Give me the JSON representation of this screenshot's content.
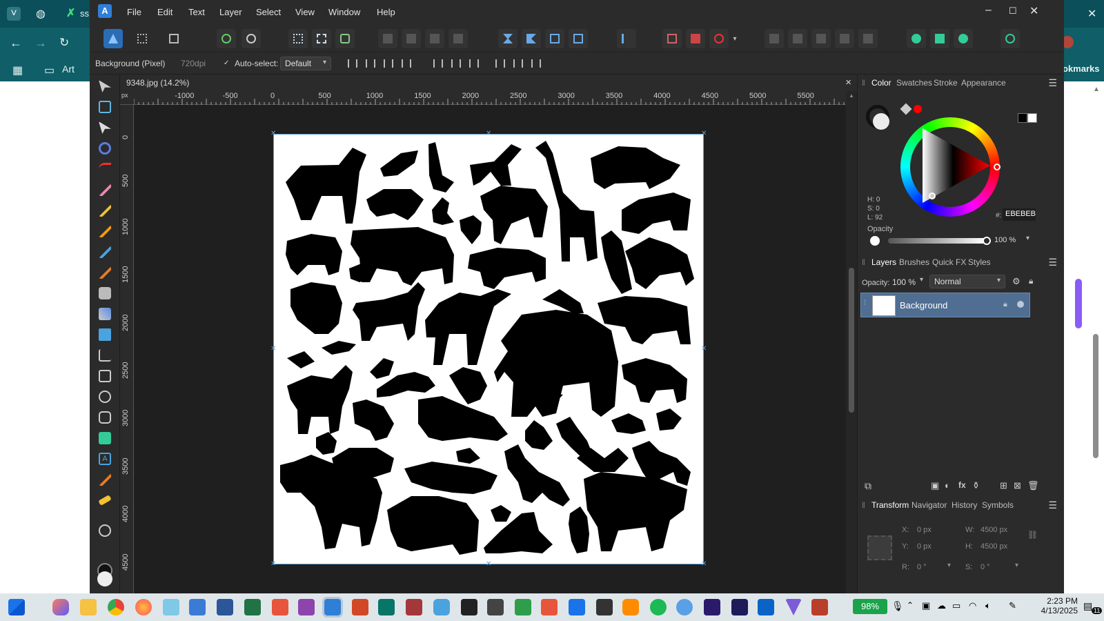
{
  "browser": {
    "tab_label": "ss",
    "bookmarks": {
      "art": "Art",
      "bookmarks": "okmarks"
    }
  },
  "menubar": {
    "items": [
      "File",
      "Edit",
      "Text",
      "Layer",
      "Select",
      "View",
      "Window",
      "Help"
    ]
  },
  "context": {
    "layer_label": "Background (Pixel)",
    "dpi": "720dpi",
    "auto_select_label": "Auto-select:",
    "auto_select_value": "Default"
  },
  "document": {
    "tab_title": "9348.jpg (14.2%)",
    "close": "×",
    "ruler_unit": "px",
    "ruler_h_labels": [
      "-1000",
      "-500",
      "0",
      "500",
      "1000",
      "1500",
      "2000",
      "2500",
      "3000",
      "3500",
      "4000",
      "4500",
      "5000",
      "5500"
    ],
    "ruler_v_labels": [
      "0",
      "500",
      "1000",
      "1500",
      "2000",
      "2500",
      "3000",
      "3500",
      "4000",
      "4500"
    ]
  },
  "color_panel": {
    "tabs": [
      "Color",
      "Swatches",
      "Stroke",
      "Appearance"
    ],
    "h": "H: 0",
    "s": "S: 0",
    "l": "L: 92",
    "hex_label": "#:",
    "hex_value": "EBEBEB",
    "opacity_label": "Opacity",
    "opacity_value": "100 %"
  },
  "layers_panel": {
    "tabs": [
      "Layers",
      "Brushes",
      "Quick FX",
      "Styles"
    ],
    "opacity_label": "Opacity:",
    "opacity_value": "100 %",
    "blend_mode": "Normal",
    "layer_name": "Background"
  },
  "transform_panel": {
    "tabs": [
      "Transform",
      "Navigator",
      "History",
      "Symbols"
    ],
    "x_label": "X:",
    "x_value": "0 px",
    "y_label": "Y:",
    "y_value": "0 px",
    "w_label": "W:",
    "w_value": "4500 px",
    "h_label": "H:",
    "h_value": "4500 px",
    "r_label": "R:",
    "r_value": "0 °",
    "s_label": "S:",
    "s_value": "0 °"
  },
  "taskbar": {
    "battery": "98%",
    "time": "2:23 PM",
    "date": "4/13/2025",
    "notifications": "11"
  },
  "colors": {
    "accent": "#2a6db5",
    "primary_swatch": "#ebebeb",
    "secondary_swatch": "#ff0000"
  }
}
